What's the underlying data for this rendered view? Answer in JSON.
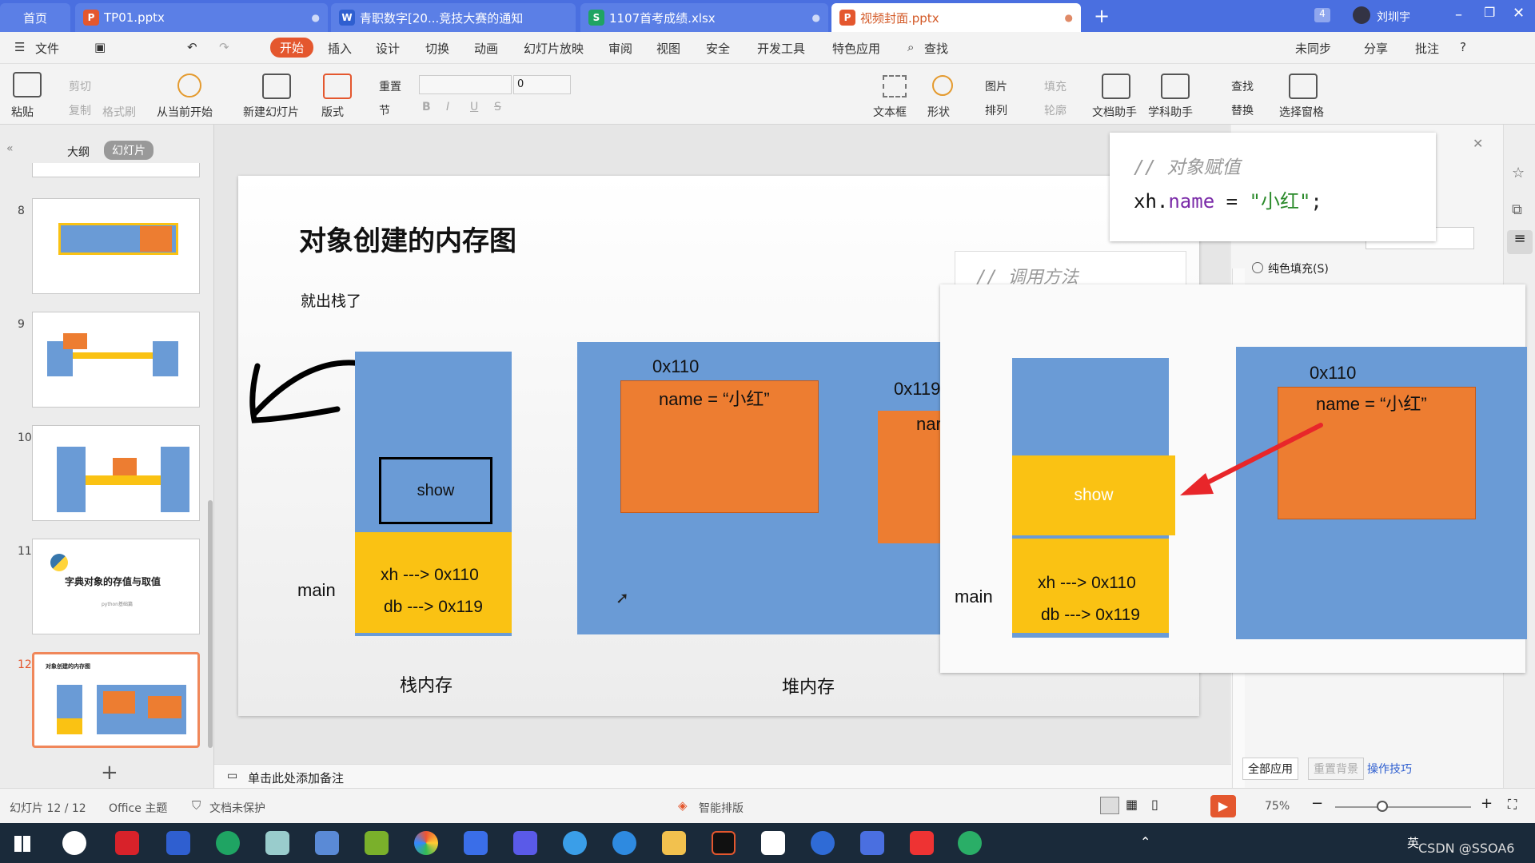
{
  "tabs": [
    {
      "label": "首页",
      "icon": ""
    },
    {
      "label": "TP01.pptx",
      "icon": "P"
    },
    {
      "label": "青职数字[20...竞技大赛的通知",
      "icon": "W"
    },
    {
      "label": "1107首考成绩.xlsx",
      "icon": "S"
    },
    {
      "label": "视频封面.pptx",
      "icon": "P"
    }
  ],
  "window": {
    "badge": "4",
    "user": "刘圳宇"
  },
  "menu": {
    "file": "文件",
    "items": [
      "开始",
      "插入",
      "设计",
      "切换",
      "动画",
      "幻灯片放映",
      "审阅",
      "视图",
      "安全",
      "开发工具",
      "特色应用",
      "查找"
    ],
    "right": [
      "未同步",
      "分享",
      "批注"
    ]
  },
  "ribbon": {
    "paste": "粘贴",
    "cut": "剪切",
    "copy": "复制",
    "format_painter": "格式刷",
    "from_start": "从当前开始",
    "new_slide": "新建幻灯片",
    "layout": "版式",
    "reset": "重置",
    "section": "节",
    "font_size": "0",
    "textbox": "文本框",
    "shape": "形状",
    "picture": "图片",
    "arrange": "排列",
    "fill": "填充",
    "outline": "轮廓",
    "doc_helper": "文档助手",
    "subject_helper": "学科助手",
    "find": "查找",
    "replace": "替换",
    "select_pane": "选择窗格"
  },
  "left_panel": {
    "tab_outline": "大纲",
    "tab_slides": "幻灯片",
    "thumbs": [
      {
        "num": "8"
      },
      {
        "num": "9"
      },
      {
        "num": "10"
      },
      {
        "num": "11",
        "title": "字典对象的存值与取值",
        "sub": "python基础篇"
      },
      {
        "num": "12",
        "title": "对象创建的内存图"
      }
    ]
  },
  "slide": {
    "title": "对象创建的内存图",
    "subtitle": "就出栈了",
    "show": "show",
    "main": "main",
    "stack_line1": "xh ---> 0x110",
    "stack_line2": "db ---> 0x119",
    "addr1": "0x110",
    "name1": "name = “小红”",
    "addr2": "0x119",
    "name2_partial": "nar",
    "stack_label": "栈内存",
    "heap_label": "堆内存"
  },
  "overlay_code1": {
    "comment": "// 对象赋值",
    "code_obj": "xh.",
    "code_prop": "name",
    "code_eq": " = ",
    "code_str": "\"小红\"",
    "code_end": ";"
  },
  "overlay_code2": {
    "comment": "// 调用方法"
  },
  "overlay_diagram": {
    "addr": "0x110",
    "name": "name = “小红”",
    "show": "show",
    "main": "main",
    "line1": "xh ---> 0x110",
    "line2": "db ---> 0x119"
  },
  "right_panel": {
    "fill_option": "纯色填充(S)",
    "apply_all": "全部应用",
    "reset_bg": "重置背景",
    "tips": "操作技巧"
  },
  "notes": {
    "placeholder": "单击此处添加备注"
  },
  "status": {
    "slide_count": "幻灯片 12 / 12",
    "theme": "Office 主题",
    "protect": "文档未保护",
    "smart_layout": "智能排版",
    "zoom": "75%"
  },
  "taskbar": {
    "watermark": "CSDN @SSOA6",
    "ime": "英"
  },
  "colors": {
    "accent": "#e4572e",
    "tab_bar": "#4a6fe0",
    "blue_box": "#6a9bd6",
    "orange_box": "#ed7d31",
    "yellow_box": "#fac213"
  }
}
